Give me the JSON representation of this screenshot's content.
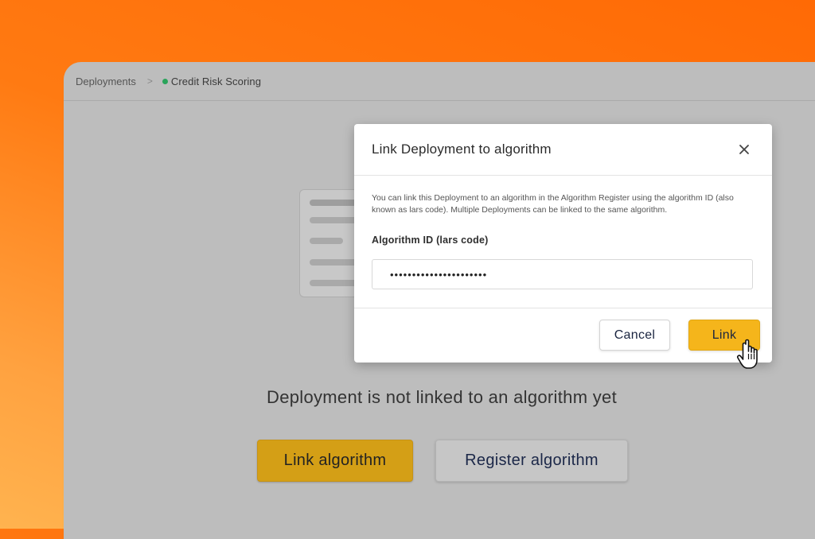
{
  "breadcrumb": {
    "root": "Deployments",
    "separator": ">",
    "current": "Credit Risk Scoring",
    "status_color": "#2aa35a"
  },
  "empty_state": {
    "message": "Deployment is not linked to an algorithm yet",
    "link_button": "Link algorithm",
    "register_button": "Register algorithm"
  },
  "modal": {
    "title": "Link Deployment to algorithm",
    "close_icon": "close-icon",
    "description": "You can link this Deployment to an algorithm in the Algorithm Register using the algorithm ID (also known as lars code). Multiple Deployments can be linked to the same algorithm.",
    "field_label": "Algorithm ID (lars code)",
    "field_value": "••••••••••••••••••••••",
    "cancel_label": "Cancel",
    "link_label": "Link"
  },
  "colors": {
    "background_orange": "#ff6a05",
    "primary_button": "#f5b51b",
    "overlay_gray": "#bdbdbd"
  },
  "cursor_icon": "pointer-hand-icon"
}
